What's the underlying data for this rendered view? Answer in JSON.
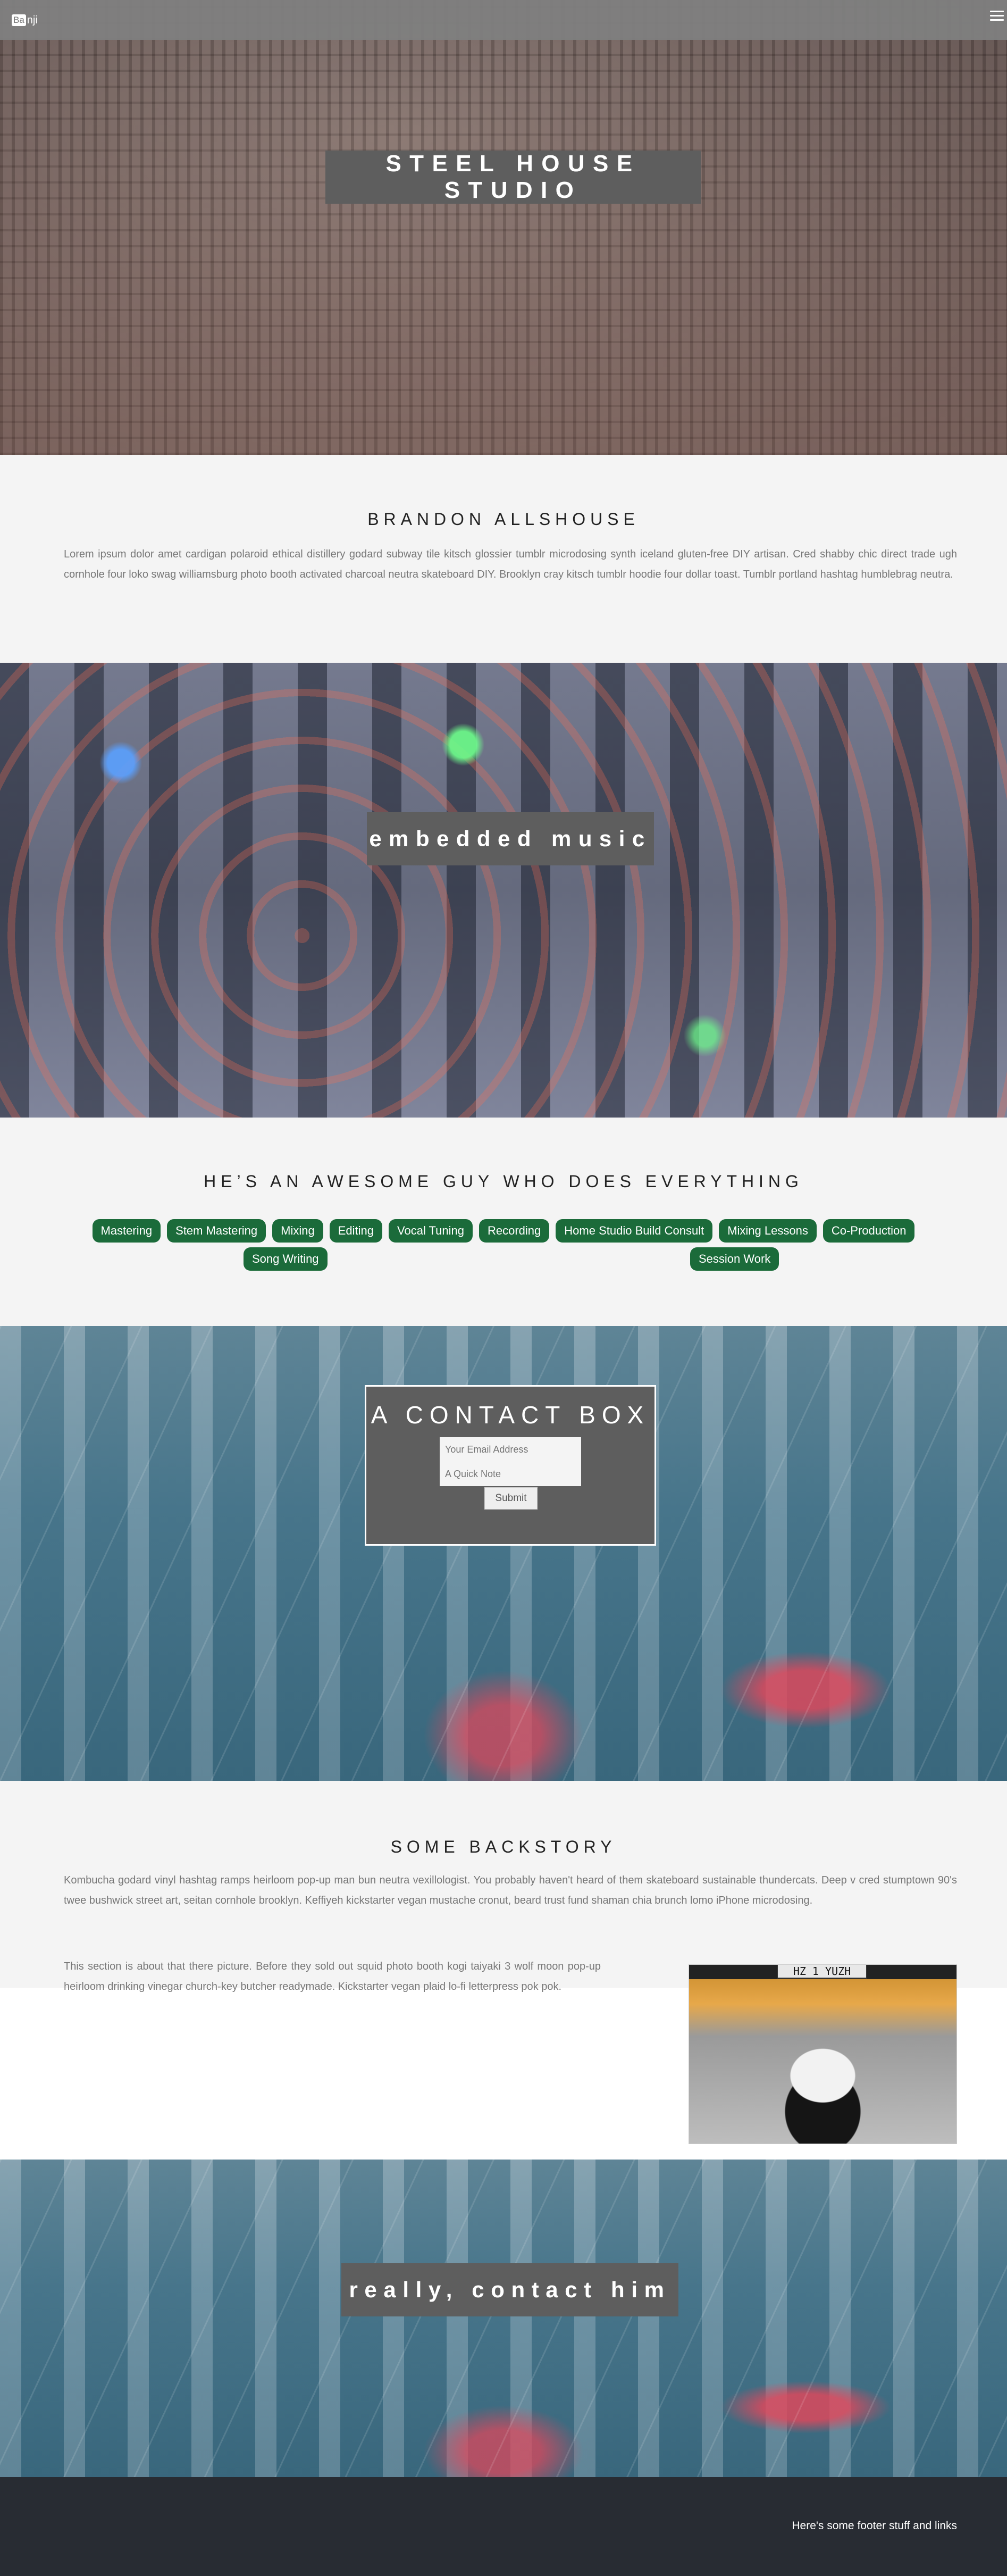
{
  "nav": {
    "logo_mark": "Ba",
    "logo_rest": "nji",
    "menu_icon": "hamburger-menu-icon"
  },
  "hero": {
    "title": "STEEL HOUSE STUDIO"
  },
  "about": {
    "heading": "BRANDON ALLSHOUSE",
    "body": "Lorem ipsum dolor amet cardigan polaroid ethical distillery godard subway tile kitsch glossier tumblr microdosing synth iceland gluten-free DIY artisan. Cred shabby chic direct trade ugh cornhole four loko swag williamsburg photo booth activated charcoal neutra skateboard DIY. Brooklyn cray kitsch tumblr hoodie four dollar toast. Tumblr portland hashtag humblebrag neutra."
  },
  "music": {
    "title": "embedded music"
  },
  "skills": {
    "heading": "HE’S AN AWESOME GUY WHO DOES EVERYTHING",
    "row1": [
      "Mastering",
      "Stem Mastering",
      "Mixing",
      "Editing",
      "Vocal Tuning",
      "Recording",
      "Home Studio Build Consult",
      "Mixing Lessons",
      "Co-Production"
    ],
    "row2_left": "Song Writing",
    "row2_right": "Session Work",
    "tag_color": "#1b6b3a"
  },
  "contact": {
    "title": "A CONTACT BOX",
    "email_placeholder": "Your Email Address",
    "note_placeholder": "A Quick Note",
    "submit_label": "Submit"
  },
  "backstory": {
    "heading": "SOME BACKSTORY",
    "body": "Kombucha godard vinyl hashtag ramps heirloom pop-up man bun neutra vexillologist. You probably haven't heard of them skateboard sustainable thundercats. Deep v cred stumptown 90's twee bushwick street art, seitan cornhole brooklyn. Keffiyeh kickstarter vegan mustache cronut, beard trust fund shaman chia brunch lomo iPhone microdosing.",
    "side_text": "This section is about that there picture. Before they sold out squid photo booth kogi taiyaki 3 wolf moon pop-up heirloom drinking vinegar church-key butcher readymade. Kickstarter vegan plaid lo-fi letterpress pok pok.",
    "plate_text": "HZ 1 YUZH"
  },
  "cta": {
    "title": "really, contact him"
  },
  "footer": {
    "text": "Here's some footer stuff and links"
  }
}
